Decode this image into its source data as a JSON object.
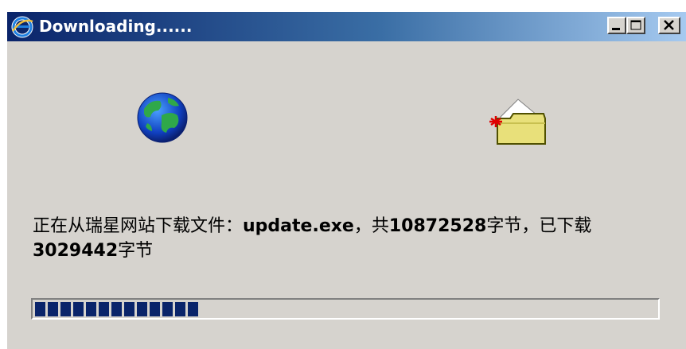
{
  "window": {
    "title": "Downloading......",
    "title_icon": "ie-icon",
    "buttons": [
      "minimize-icon",
      "maximize-icon",
      "close-icon"
    ]
  },
  "icons": {
    "left": "globe-icon",
    "right": "folder-icon"
  },
  "status": {
    "prefix": "正在从瑞星网站下载文件：",
    "filename": "update.exe",
    "mid1": "，共",
    "total_bytes": "10872528",
    "mid2": "字节，已下载",
    "downloaded_bytes": "3029442",
    "suffix": "字节"
  },
  "progress": {
    "fraction": 0.2786
  },
  "colors": {
    "titlebar_start": "#0a246a",
    "titlebar_end": "#a6caf0",
    "face": "#d6d3ce",
    "progress_fill": "#0a246a"
  }
}
